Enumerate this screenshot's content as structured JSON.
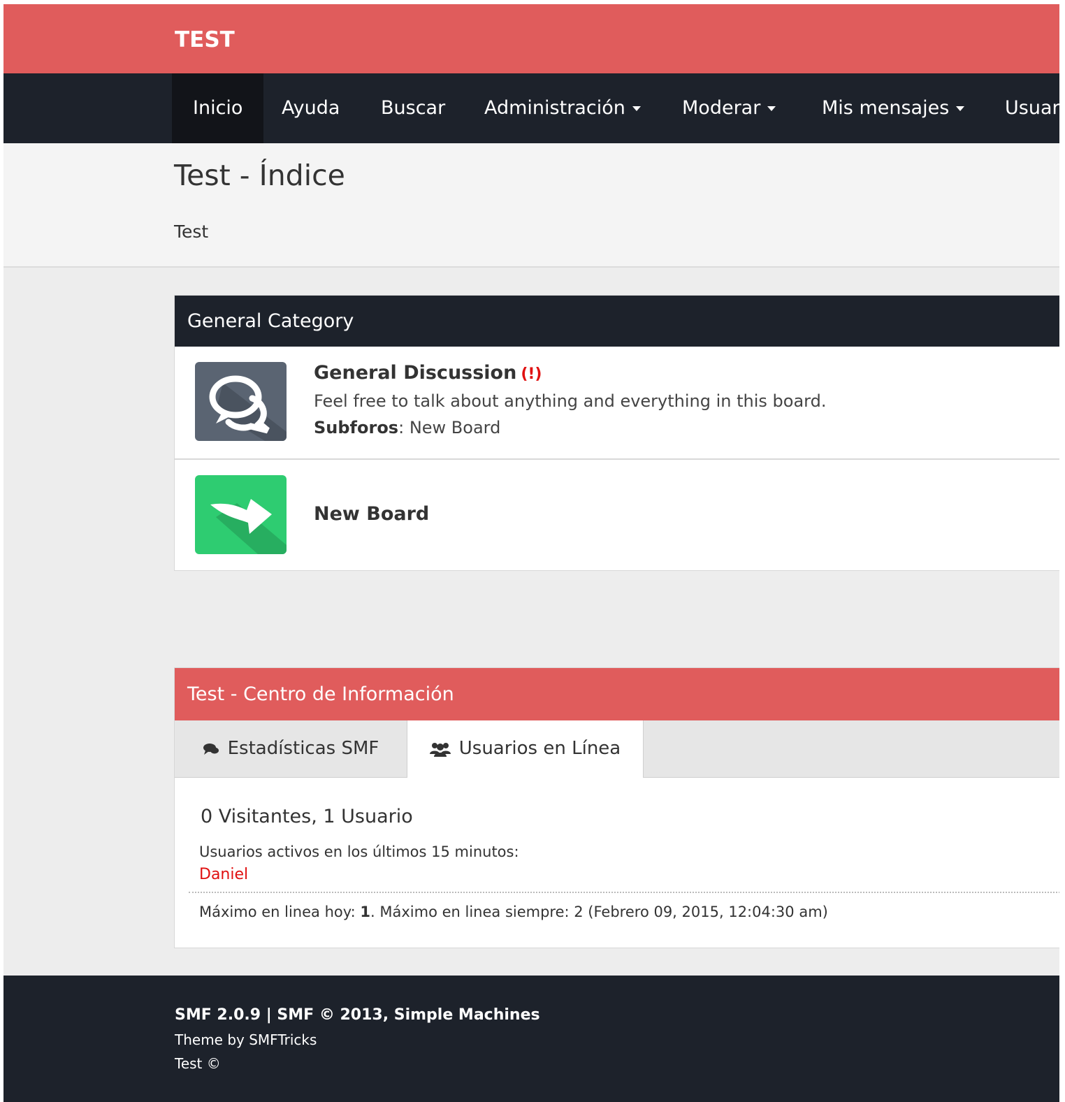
{
  "colors": {
    "brand": "#e05c5c",
    "nav": "#1d222b",
    "alert": "#e01010"
  },
  "header": {
    "brand": "TEST"
  },
  "nav": {
    "items": [
      {
        "label": "Inicio",
        "active": true
      },
      {
        "label": "Ayuda"
      },
      {
        "label": "Buscar"
      },
      {
        "label": "Administración",
        "dropdown": true
      },
      {
        "label": "Moderar",
        "dropdown": true
      },
      {
        "label": "Mis mensajes",
        "dropdown": true
      },
      {
        "label": "Usuar"
      }
    ]
  },
  "title": {
    "heading": "Test - Índice",
    "subtitle": "Test"
  },
  "category": {
    "name": "General Category",
    "boards": [
      {
        "name": "General Discussion",
        "flag": "(!)",
        "description": "Feel free to talk about anything and everything in this board.",
        "subforos_label": "Subforos",
        "subforos_sep": ": ",
        "subforos_link": "New Board",
        "icon": "speech-bubbles-icon"
      },
      {
        "name": "New Board",
        "icon": "redirect-arrow-icon"
      }
    ]
  },
  "info": {
    "title": "Test - Centro de Información",
    "tabs": [
      {
        "label": "Estadísticas SMF",
        "icon": "comments-icon"
      },
      {
        "label": "Usuarios en Línea",
        "icon": "users-icon",
        "active": true
      }
    ],
    "online_count": "0 Visitantes, 1 Usuario",
    "active_label": "Usuarios activos en los últimos 15 minutos:",
    "user": "Daniel",
    "max_prefix": "Máximo en linea hoy: ",
    "max_today": "1",
    "max_suffix": ". Máximo en linea siempre: 2 (Febrero 09, 2015, 12:04:30 am)"
  },
  "footer": {
    "line1": "SMF 2.0.9 | SMF © 2013, Simple Machines",
    "line2": "Theme by SMFTricks",
    "line3": "Test ©"
  }
}
